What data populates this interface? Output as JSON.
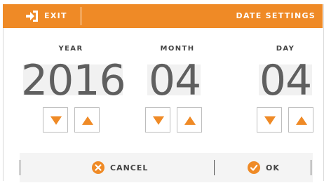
{
  "header": {
    "exit_label": "EXIT",
    "title": "DATE SETTINGS",
    "background_color": "#ef8a26"
  },
  "date": {
    "year": {
      "label": "YEAR",
      "value": "2016"
    },
    "month": {
      "label": "MONTH",
      "value": "04"
    },
    "day": {
      "label": "DAY",
      "value": "04"
    }
  },
  "controls": {
    "decrement_icon": "triangle-down",
    "increment_icon": "triangle-up",
    "arrow_color": "#ef8a26"
  },
  "footer": {
    "cancel_label": "CANCEL",
    "ok_label": "OK",
    "cancel_icon": "x-circle",
    "ok_icon": "check-circle"
  }
}
